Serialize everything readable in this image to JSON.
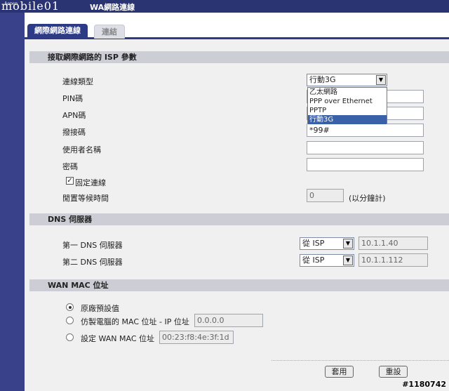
{
  "window": {
    "brand": "mobile01",
    "brand_small": "Aopen",
    "title": "網路連線",
    "title_prefix": "WA"
  },
  "tabs": [
    {
      "label": "網際網路連線",
      "active": true
    },
    {
      "label": "連結",
      "active": false
    }
  ],
  "isp": {
    "section_title": "接取網際網路的 ISP 參數",
    "connection_type_label": "連線類型",
    "connection_type_value": "行動3G",
    "dropdown_options": [
      "乙太網路",
      "PPP over Ethernet",
      "PPTP",
      "行動3G"
    ],
    "pin_label": "PIN碼",
    "pin_value": "",
    "apn_label": "APN碼",
    "apn_value": "",
    "dial_label": "撥接碼",
    "dial_value": "*99#",
    "username_label": "使用者名稱",
    "username_value": "",
    "password_label": "密碼",
    "password_value": "",
    "fixed_conn_label": "固定連線",
    "fixed_conn_checked": true,
    "idle_label": "閒置等候時間",
    "idle_value": "0",
    "idle_unit": "(以分鐘計)"
  },
  "dns": {
    "section_title": "DNS 伺服器",
    "dns1_label": "第一 DNS 伺服器",
    "dns1_mode": "從 ISP",
    "dns1_value": "10.1.1.40",
    "dns2_label": "第二 DNS 伺服器",
    "dns2_mode": "從 ISP",
    "dns2_value": "10.1.1.112"
  },
  "mac": {
    "section_title": "WAN MAC 位址",
    "opt_default": "原廠預設值",
    "opt_clone": "仿製電腦的 MAC 位址 - IP 位址",
    "clone_ip": "0.0.0.0",
    "opt_set": "設定 WAN MAC 位址",
    "set_mac": "00:23:f8:4e:3f:1d",
    "selected": "default"
  },
  "buttons": {
    "apply": "套用",
    "reset": "重設"
  },
  "watermark": "#1180742",
  "colors": {
    "titlebar": "#2a3472",
    "sidebar": "#38418a",
    "tab_active": "#2d3a86",
    "section": "#cdced5",
    "highlight": "#3a61a8"
  }
}
